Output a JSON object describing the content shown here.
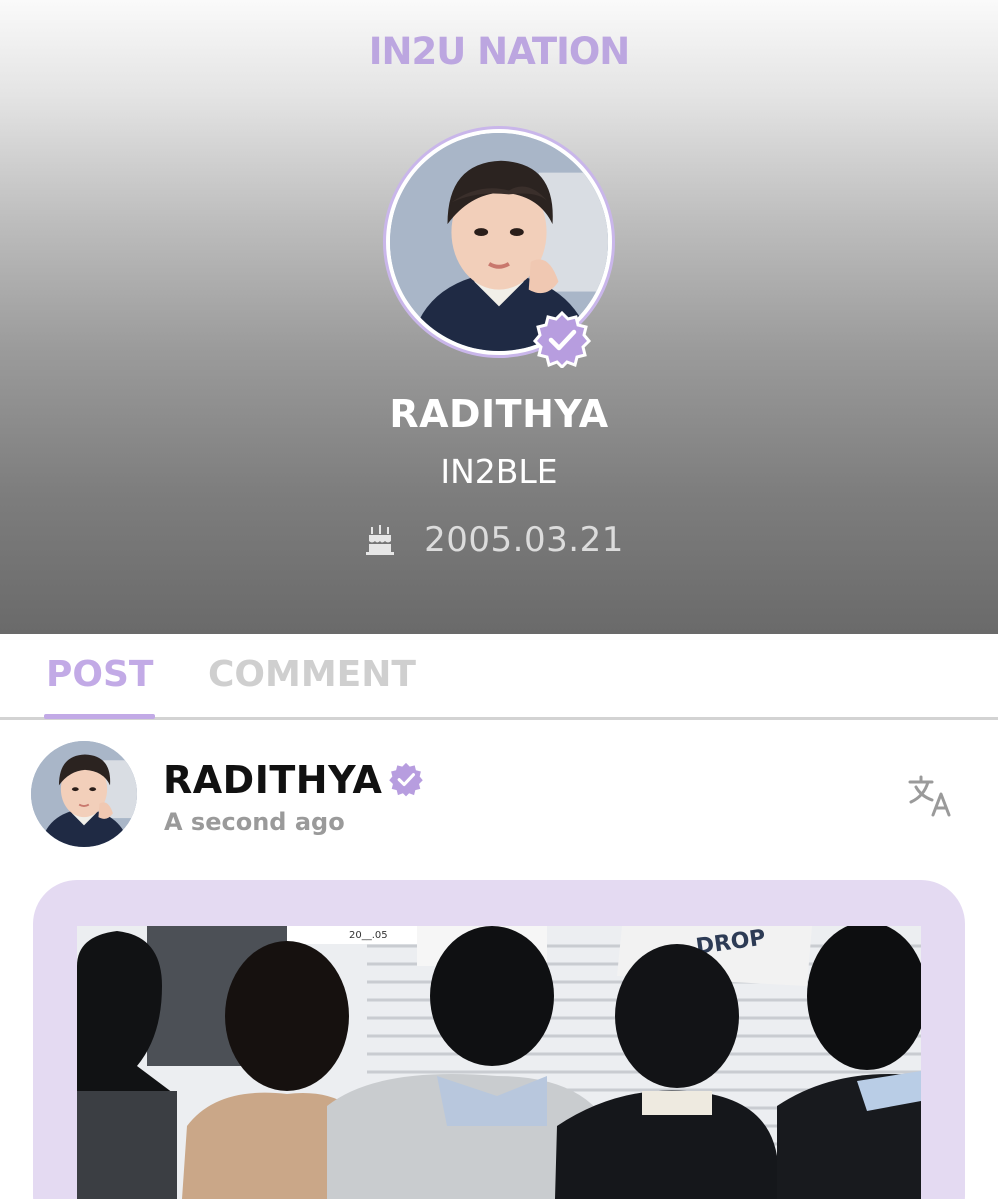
{
  "app": {
    "title": "IN2U NATION"
  },
  "profile": {
    "name": "RADITHYA",
    "group": "IN2BLE",
    "birthday": "2005.03.21",
    "icons": {
      "verified": "verified-badge-icon",
      "birthday": "cake-icon"
    }
  },
  "tabs": [
    {
      "label": "POST",
      "active": true
    },
    {
      "label": "COMMENT",
      "active": false
    }
  ],
  "post": {
    "author": "RADITHYA",
    "time": "A second ago",
    "translate_icon": "translate-icon",
    "image_text": {
      "left_paper": "20__.05",
      "right_paper": "DROP"
    }
  },
  "colors": {
    "accent": "#bca6e0",
    "tab_active": "#c2aae6",
    "tab_inactive": "#cfcfcf",
    "card_bg": "#e4daf2",
    "verified": "#b79ddf"
  }
}
